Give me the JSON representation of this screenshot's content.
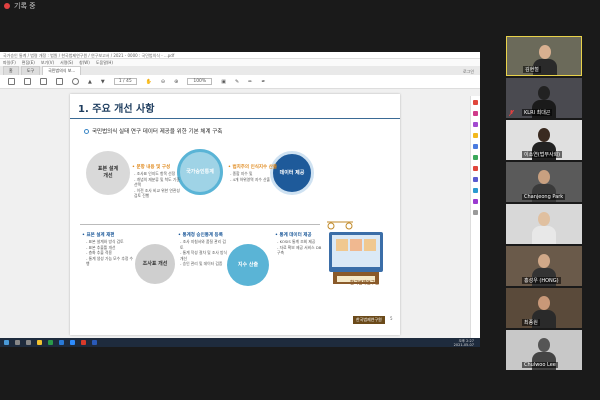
{
  "recording": {
    "label": "기록 중"
  },
  "app": {
    "window_title": "국가승인 통계 / 법령 개정 : 법원 / 한국법제연구원 / 연구보고서 / 2021 - 0000 : 국민법의식 - ...pdf",
    "menu": [
      "파일(F)",
      "편집(E)",
      "보기(V)",
      "서명(S)",
      "창(W)",
      "도움말(H)"
    ],
    "tabs": [
      "홈",
      "도구",
      "국민법의식 보..."
    ],
    "sign_in": "로그인",
    "page_indicator": "1 / 45",
    "zoom": "100%"
  },
  "slide": {
    "title": "1. 주요 개선 사항",
    "subtitle": "국민법의식 실태 연구 데이터 제공을 위한 기본 체계 구축",
    "circles": [
      {
        "label": "표본 설계\n개선"
      },
      {
        "label": "조사표 개선"
      },
      {
        "label": "국가승인통계"
      },
      {
        "label": "지수 산출"
      },
      {
        "label": "데이터 제공"
      }
    ],
    "blocks": [
      {
        "heading": "• 표본 설계 재편",
        "items": [
          "- 표본 설계와 방식 검토",
          "- 표본 추출틀 개선",
          "- 층화 추출 적용",
          "- 통계 생성 가능 모수 추정 수행"
        ]
      },
      {
        "heading": "• 문항 내용 및 구성",
        "items": [
          "- 조사표 인지도 항목 선정",
          "- 개념의 재분류 및 척도 기준 선택",
          "- 이전 조사 비교 위한 연관성 검토 진행"
        ]
      },
      {
        "heading": "• 통계청 승인통계 등록",
        "items": [
          "- 조사 지침서와 품질 관리 검토",
          "- 통계 작성 절차 및 조사 방식 개선",
          "- 승인 관리 및 데이터 검증"
        ]
      },
      {
        "heading": "• 법치주의 인식지수 산출",
        "items": [
          "- 종합 지수 및",
          "- 4개 하위영역 지수 산출"
        ]
      },
      {
        "heading": "• 통계 데이터 제공",
        "items": [
          "- KOSIS 통계 조회 제공",
          "- 자료 확보 제공 서비스 DB 구축"
        ]
      }
    ],
    "logo": "한국법제연구원",
    "page": "5"
  },
  "taskbar": {
    "time": "오후 2:27",
    "date": "2021-05-07"
  },
  "participants": [
    {
      "name": "김현철",
      "active": true
    },
    {
      "name": "KLRI 최대곤"
    },
    {
      "name": "이소연(법무사회)"
    },
    {
      "name": "Chanjeong Park"
    },
    {
      "name": ""
    },
    {
      "name": "홍성우 (HONG)"
    },
    {
      "name": "최종원"
    },
    {
      "name": "Chulwoo Lee"
    }
  ],
  "colors": {
    "title_navy": "#1d3c5e",
    "circle_gray": "#d9d9d9",
    "circle_teal": "#5ab4d6",
    "circle_navy": "#1e5a9a",
    "accent_orange": "#e08a1e",
    "active_border": "#e8d24a"
  }
}
